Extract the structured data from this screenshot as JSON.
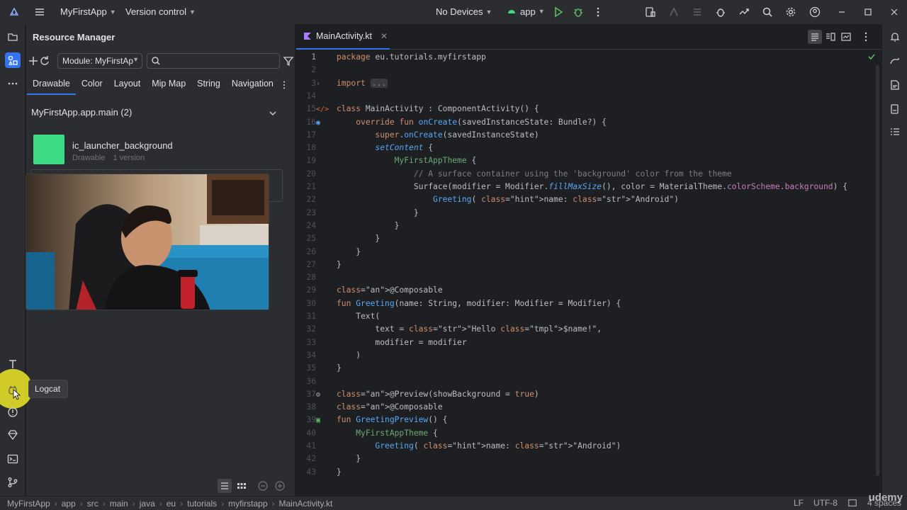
{
  "titlebar": {
    "project": "MyFirstApp",
    "vcs": "Version control",
    "devices": "No Devices",
    "run_config": "app"
  },
  "resource_manager": {
    "title": "Resource Manager",
    "module": "Module: MyFirstAp",
    "tabs": [
      "Drawable",
      "Color",
      "Layout",
      "Mip Map",
      "String",
      "Navigation"
    ],
    "group": "MyFirstApp.app.main (2)",
    "item": {
      "name": "ic_launcher_background",
      "type": "Drawable",
      "versions": "1 version"
    },
    "tooltip": "Logcat"
  },
  "editor": {
    "tab": "MainActivity.kt",
    "lines": [
      {
        "n": "1",
        "t": "package eu.tutorials.myfirstapp"
      },
      {
        "n": "2",
        "t": ""
      },
      {
        "n": "3",
        "t": "import ..."
      },
      {
        "n": "14",
        "t": ""
      },
      {
        "n": "15",
        "t": "class MainActivity : ComponentActivity() {"
      },
      {
        "n": "16",
        "t": "    override fun onCreate(savedInstanceState: Bundle?) {"
      },
      {
        "n": "17",
        "t": "        super.onCreate(savedInstanceState)"
      },
      {
        "n": "18",
        "t": "        setContent {"
      },
      {
        "n": "19",
        "t": "            MyFirstAppTheme {"
      },
      {
        "n": "20",
        "t": "                // A surface container using the 'background' color from the theme"
      },
      {
        "n": "21",
        "t": "                Surface(modifier = Modifier.fillMaxSize(), color = MaterialTheme.colorScheme.background) {"
      },
      {
        "n": "22",
        "t": "                    Greeting( name: \"Android\")"
      },
      {
        "n": "23",
        "t": "                }"
      },
      {
        "n": "24",
        "t": "            }"
      },
      {
        "n": "25",
        "t": "        }"
      },
      {
        "n": "26",
        "t": "    }"
      },
      {
        "n": "27",
        "t": "}"
      },
      {
        "n": "28",
        "t": ""
      },
      {
        "n": "29",
        "t": "@Composable"
      },
      {
        "n": "30",
        "t": "fun Greeting(name: String, modifier: Modifier = Modifier) {"
      },
      {
        "n": "31",
        "t": "    Text("
      },
      {
        "n": "32",
        "t": "        text = \"Hello $name!\","
      },
      {
        "n": "33",
        "t": "        modifier = modifier"
      },
      {
        "n": "34",
        "t": "    )"
      },
      {
        "n": "35",
        "t": "}"
      },
      {
        "n": "36",
        "t": ""
      },
      {
        "n": "37",
        "t": "@Preview(showBackground = true)"
      },
      {
        "n": "38",
        "t": "@Composable"
      },
      {
        "n": "39",
        "t": "fun GreetingPreview() {"
      },
      {
        "n": "40",
        "t": "    MyFirstAppTheme {"
      },
      {
        "n": "41",
        "t": "        Greeting( name: \"Android\")"
      },
      {
        "n": "42",
        "t": "    }"
      },
      {
        "n": "43",
        "t": "}"
      }
    ]
  },
  "statusbar": {
    "breadcrumbs": [
      "MyFirstApp",
      "app",
      "src",
      "main",
      "java",
      "eu",
      "tutorials",
      "myfirstapp",
      "MainActivity.kt"
    ],
    "line_sep": "LF",
    "encoding": "UTF-8",
    "indent": "4 spaces"
  },
  "watermark": "udemy",
  "colors": {
    "accent": "#3574f0",
    "android_green": "#3ddc84",
    "highlight": "#eee828"
  }
}
